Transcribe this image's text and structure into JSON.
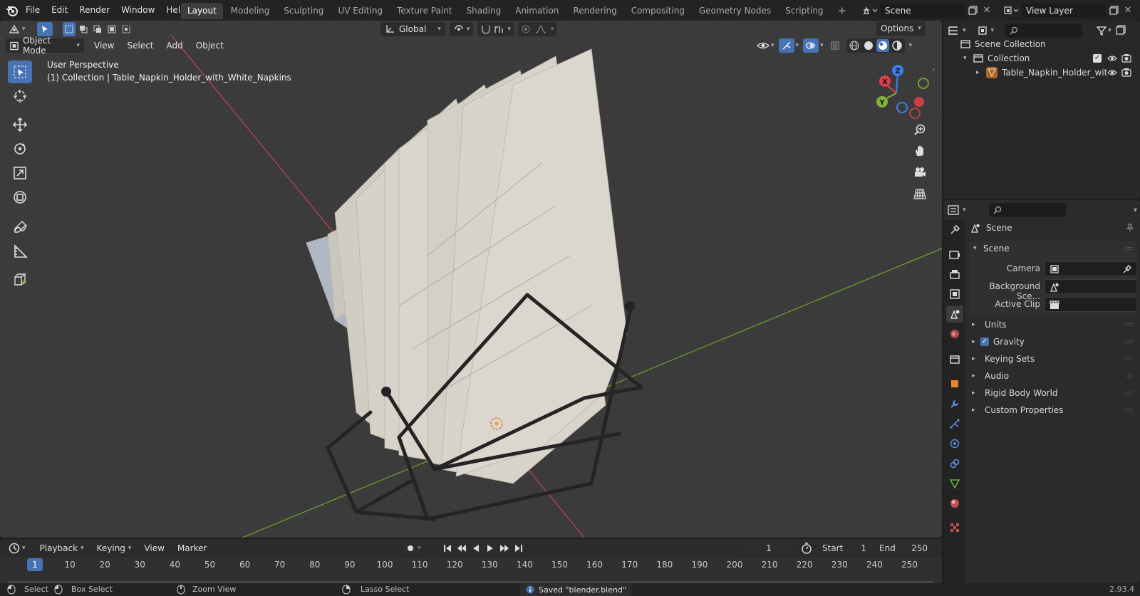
{
  "menu": [
    "File",
    "Edit",
    "Render",
    "Window",
    "Help"
  ],
  "workspaces": [
    {
      "label": "Layout",
      "active": true
    },
    {
      "label": "Modeling"
    },
    {
      "label": "Sculpting"
    },
    {
      "label": "UV Editing"
    },
    {
      "label": "Texture Paint"
    },
    {
      "label": "Shading"
    },
    {
      "label": "Animation"
    },
    {
      "label": "Rendering"
    },
    {
      "label": "Compositing"
    },
    {
      "label": "Geometry Nodes"
    },
    {
      "label": "Scripting"
    }
  ],
  "scene_selector": {
    "value": "Scene"
  },
  "view_layer_selector": {
    "value": "View Layer"
  },
  "viewport": {
    "transform_orientation": "Global",
    "options_label": "Options",
    "mode": "Object Mode",
    "header_menus": [
      "View",
      "Select",
      "Add",
      "Object"
    ],
    "overlay_title": "User Perspective",
    "overlay_subtitle": "(1) Collection | Table_Napkin_Holder_with_White_Napkins",
    "gizmo_axes": {
      "x": "X",
      "y": "Y",
      "z": "Z"
    }
  },
  "timeline": {
    "menus": [
      "Playback",
      "Keying",
      "View",
      "Marker"
    ],
    "current_frame": "1",
    "start_label": "Start",
    "start_value": "1",
    "end_label": "End",
    "end_value": "250",
    "ticks": [
      "1",
      "10",
      "20",
      "30",
      "40",
      "50",
      "60",
      "70",
      "80",
      "90",
      "100",
      "110",
      "120",
      "130",
      "140",
      "150",
      "160",
      "170",
      "180",
      "190",
      "200",
      "210",
      "220",
      "230",
      "240",
      "250"
    ]
  },
  "status": {
    "select": "Select",
    "box_select": "Box Select",
    "zoom_view": "Zoom View",
    "lasso_select": "Lasso Select",
    "message": "Saved \"blender.blend\"",
    "version": "2.93.4"
  },
  "outliner": {
    "root": "Scene Collection",
    "collection": "Collection",
    "object": "Table_Napkin_Holder_wit"
  },
  "properties": {
    "context": "Scene",
    "panel_title": "Scene",
    "fields": [
      {
        "label": "Camera"
      },
      {
        "label": "Background Sce..."
      },
      {
        "label": "Active Clip"
      }
    ],
    "subpanels": [
      {
        "label": "Units",
        "checkbox": false
      },
      {
        "label": "Gravity",
        "checkbox": true
      },
      {
        "label": "Keying Sets",
        "checkbox": false
      },
      {
        "label": "Audio",
        "checkbox": false
      },
      {
        "label": "Rigid Body World",
        "checkbox": false
      },
      {
        "label": "Custom Properties",
        "checkbox": false
      }
    ]
  },
  "colors": {
    "accent": "#4772b3",
    "axis_x": "#d9414e",
    "axis_y": "#7fb437",
    "axis_z": "#3c7ff0",
    "viewport_bg": "#3b3b3b",
    "napkin": "#d8d3ca",
    "holder": "#2a2a2a"
  }
}
